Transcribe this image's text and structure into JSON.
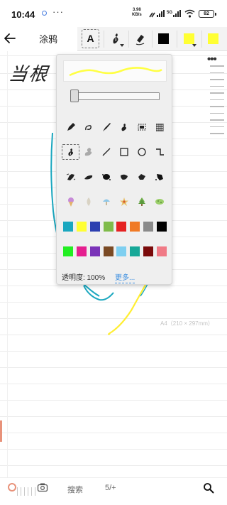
{
  "status_bar": {
    "time": "10:44",
    "more_dots": "···",
    "net_speed_value": "3.98",
    "net_speed_unit": "KB/s",
    "battery": "82"
  },
  "toolbar": {
    "title": "涂鸦",
    "text_tool_label": "A",
    "colors": {
      "black": "#000000",
      "yellow": "#ffff33"
    }
  },
  "canvas": {
    "handwriting": "当根",
    "paper_size": "A4（210 × 297mm）"
  },
  "panel": {
    "pen_preview_color": "#ffff44",
    "tool_icons": [
      [
        "pen-icon",
        "calligraphy-icon",
        "brush-icon",
        "sketch-icon",
        "dotted-rect-icon",
        "mesh-icon"
      ],
      [
        "freehand-icon",
        "smudge-icon",
        "line-icon",
        "rectangle-icon",
        "circle-icon",
        "step-line-icon"
      ],
      [
        "ink-splat-icon",
        "ink-brush-icon",
        "ink-blot-icon",
        "ink-stroke-icon",
        "ink-drop-icon",
        "ink-dab-icon"
      ],
      [
        "ice-cream-sticker-icon",
        "leaf-sticker-icon",
        "mushroom-sticker-icon",
        "star-sticker-icon",
        "tree-sticker-icon",
        "pebble-sticker-icon"
      ]
    ],
    "swatch_row_1": [
      "#1aa7bf",
      "#ffff33",
      "#2c3fb0",
      "#7fbb4a",
      "#e52222",
      "#f07a26",
      "#8a8a8a",
      "#000000"
    ],
    "swatch_row_2": [
      "#22ee22",
      "#e51f8f",
      "#7a33b8",
      "#7a4a24",
      "#7ecff0",
      "#17a898",
      "#7a0a0a",
      "#f07a86"
    ],
    "opacity_label": "透明度: 100%",
    "more_label": "更多..."
  },
  "bottom_bar": {
    "search_label": "搜索",
    "page_indicator": "5/+"
  }
}
